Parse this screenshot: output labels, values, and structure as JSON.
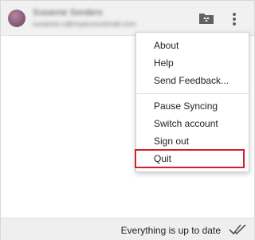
{
  "header": {
    "account_name": "Susanne Sonders",
    "account_email": "susanne.s@myaccountmail.com",
    "drive_icon": "drive-folder-icon",
    "more_icon": "more-vertical-icon"
  },
  "menu": {
    "items": [
      {
        "label": "About"
      },
      {
        "label": "Help"
      },
      {
        "label": "Send Feedback..."
      },
      {
        "label": "Pause Syncing"
      },
      {
        "label": "Switch account"
      },
      {
        "label": "Sign out"
      },
      {
        "label": "Quit"
      }
    ],
    "highlight_color": "#d4202a"
  },
  "status": {
    "text": "Everything is up to date",
    "icon": "double-check-icon"
  }
}
